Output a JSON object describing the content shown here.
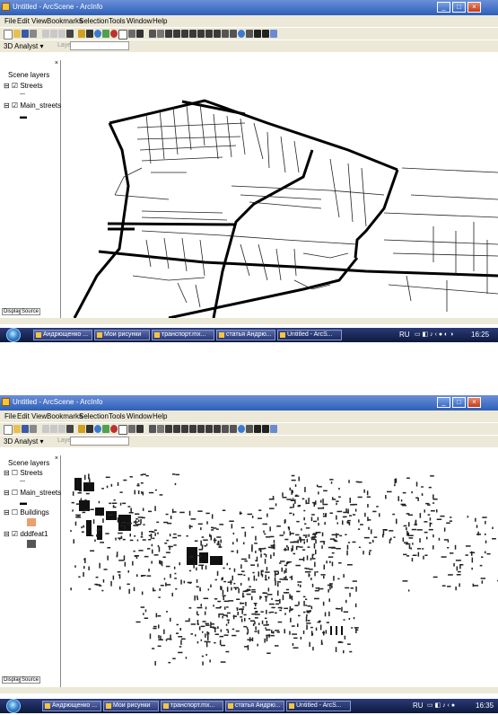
{
  "screen1": {
    "title": "Untitled - ArcScene - ArcInfo",
    "window_controls": {
      "minimize": "_",
      "maximize": "□",
      "close": "×"
    },
    "menu": [
      "File",
      "Edit",
      "View",
      "Bookmarks",
      "Selection",
      "Tools",
      "Window",
      "Help"
    ],
    "analyst_label": "3D Analyst ▾",
    "layer_label": "Layer",
    "toc": {
      "title": "Scene layers",
      "close": "×",
      "layers": [
        "Streets",
        "Main_streets"
      ],
      "tabs": [
        "Display",
        "Source"
      ]
    },
    "taskbar": {
      "tasks": [
        "Андрющенко ...",
        "Мои рисунки",
        "транспорт.mx...",
        "статья Андрю...",
        "Untitled - ArcS..."
      ],
      "lang": "RU",
      "clock": "16:25"
    }
  },
  "screen2": {
    "title": "Untitled - ArcScene - ArcInfo",
    "window_controls": {
      "minimize": "_",
      "maximize": "□",
      "close": "×"
    },
    "menu": [
      "File",
      "Edit",
      "View",
      "Bookmarks",
      "Selection",
      "Tools",
      "Window",
      "Help"
    ],
    "analyst_label": "3D Analyst ▾",
    "layer_label": "Layer",
    "toc": {
      "title": "Scene layers",
      "close": "×",
      "layers": [
        "Streets",
        "Main_streets",
        "Buildings",
        "dddfeat1"
      ],
      "tabs": [
        "Display",
        "Source"
      ]
    },
    "taskbar": {
      "tasks": [
        "Андрющенко ...",
        "Мои рисунки",
        "транспорт.mx...",
        "статья Андрю...",
        "Untitled - ArcS..."
      ],
      "lang": "RU",
      "clock": "16:35"
    }
  },
  "colors": {
    "titlebar": "#2d5fb8",
    "chrome": "#ece9d8",
    "taskbar": "#1a2a5c",
    "buildings_swatch": "#e8a070",
    "dddfeat_swatch": "#555555"
  },
  "icons": [
    "app-icon",
    "new-icon",
    "open-icon",
    "save-icon",
    "print-icon",
    "cut-icon",
    "copy-icon",
    "paste-icon",
    "delete-icon",
    "navigate-icon",
    "zoom-in-icon",
    "zoom-out-icon",
    "pan-icon",
    "identify-icon",
    "start-orb-icon"
  ]
}
